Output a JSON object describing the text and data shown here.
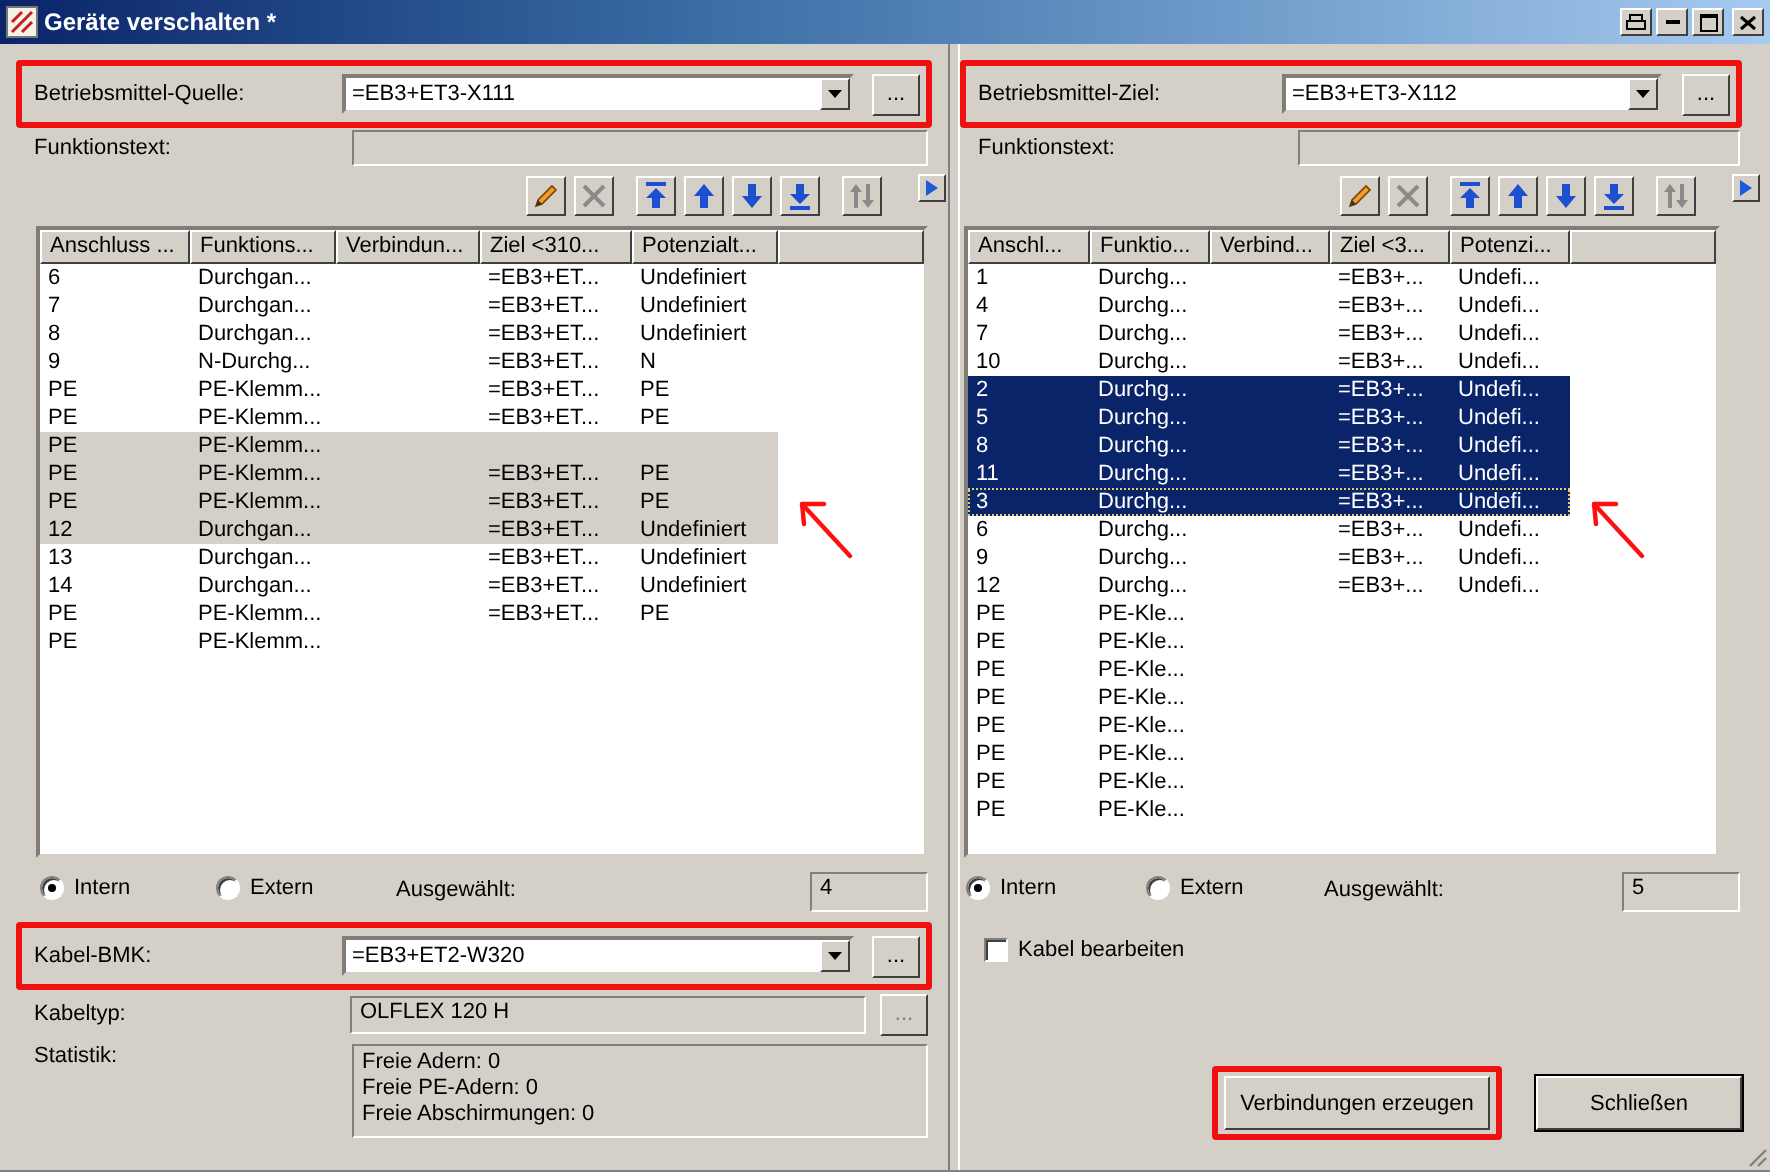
{
  "window": {
    "title": "Geräte verschalten *"
  },
  "source": {
    "highlighted": true,
    "label": "Betriebsmittel-Quelle:",
    "value": "=EB3+ET3-X111",
    "browse_label": "...",
    "function_label": "Funktionstext:",
    "toolbar": [
      {
        "kind": "edit",
        "disabled": false
      },
      {
        "kind": "delete",
        "disabled": true
      },
      {
        "kind": "top",
        "disabled": false
      },
      {
        "kind": "up",
        "disabled": false
      },
      {
        "kind": "down",
        "disabled": false
      },
      {
        "kind": "bottom",
        "disabled": false
      },
      {
        "kind": "swap",
        "disabled": true
      },
      {
        "kind": "more",
        "disabled": false
      }
    ],
    "table": {
      "focused": false,
      "annotation_arrow": true,
      "columns": [
        "Anschluss ...",
        "Funktions...",
        "Verbindun...",
        "Ziel <310...",
        "Potenzialt..."
      ],
      "rows": [
        {
          "cells": [
            "6",
            "Durchgan...",
            null,
            "=EB3+ET...",
            "Undefiniert"
          ],
          "selected": false,
          "focused": false
        },
        {
          "cells": [
            "7",
            "Durchgan...",
            null,
            "=EB3+ET...",
            "Undefiniert"
          ],
          "selected": false,
          "focused": false
        },
        {
          "cells": [
            "8",
            "Durchgan...",
            null,
            "=EB3+ET...",
            "Undefiniert"
          ],
          "selected": false,
          "focused": false
        },
        {
          "cells": [
            "9",
            "N-Durchg...",
            null,
            "=EB3+ET...",
            "N"
          ],
          "selected": false,
          "focused": false
        },
        {
          "cells": [
            "PE",
            "PE-Klemm...",
            null,
            "=EB3+ET...",
            "PE"
          ],
          "selected": false,
          "focused": false
        },
        {
          "cells": [
            "PE",
            "PE-Klemm...",
            null,
            "=EB3+ET...",
            "PE"
          ],
          "selected": false,
          "focused": false
        },
        {
          "cells": [
            "PE",
            "PE-Klemm...",
            null,
            null,
            null
          ],
          "selected": true,
          "focused": false
        },
        {
          "cells": [
            "PE",
            "PE-Klemm...",
            null,
            "=EB3+ET...",
            "PE"
          ],
          "selected": true,
          "focused": false
        },
        {
          "cells": [
            "PE",
            "PE-Klemm...",
            null,
            "=EB3+ET...",
            "PE"
          ],
          "selected": true,
          "focused": false
        },
        {
          "cells": [
            "12",
            "Durchgan...",
            null,
            "=EB3+ET...",
            "Undefiniert"
          ],
          "selected": true,
          "focused": false
        },
        {
          "cells": [
            "13",
            "Durchgan...",
            null,
            "=EB3+ET...",
            "Undefiniert"
          ],
          "selected": false,
          "focused": false
        },
        {
          "cells": [
            "14",
            "Durchgan...",
            null,
            "=EB3+ET...",
            "Undefiniert"
          ],
          "selected": false,
          "focused": false
        },
        {
          "cells": [
            "PE",
            "PE-Klemm...",
            null,
            "=EB3+ET...",
            "PE"
          ],
          "selected": false,
          "focused": false
        },
        {
          "cells": [
            "PE",
            "PE-Klemm...",
            null,
            null,
            null
          ],
          "selected": false,
          "focused": false
        }
      ]
    },
    "radios": [
      {
        "label": "Intern",
        "selected": true
      },
      {
        "label": "Extern",
        "selected": false
      }
    ],
    "count_label": "Ausgewählt:",
    "count": "4"
  },
  "cable": {
    "highlighted": true,
    "label": "Kabel-BMK:",
    "value": "=EB3+ET2-W320",
    "browse_label": "...",
    "type_label": "Kabeltyp:",
    "type_value": "OLFLEX 120 H",
    "type_browse_label": "...",
    "stats_label": "Statistik:",
    "stats": [
      "Freie Adern: 0",
      "Freie PE-Adern: 0",
      "Freie Abschirmungen: 0"
    ]
  },
  "target": {
    "highlighted": true,
    "label": "Betriebsmittel-Ziel:",
    "value": "=EB3+ET3-X112",
    "browse_label": "...",
    "function_label": "Funktionstext:",
    "toolbar": [
      {
        "kind": "edit",
        "disabled": false
      },
      {
        "kind": "delete",
        "disabled": true
      },
      {
        "kind": "top",
        "disabled": false
      },
      {
        "kind": "up",
        "disabled": false
      },
      {
        "kind": "down",
        "disabled": false
      },
      {
        "kind": "bottom",
        "disabled": false
      },
      {
        "kind": "swap",
        "disabled": true
      },
      {
        "kind": "more",
        "disabled": false
      }
    ],
    "table": {
      "focused": true,
      "annotation_arrow": true,
      "columns": [
        "Anschl...",
        "Funktio...",
        "Verbind...",
        "Ziel <3...",
        "Potenzi..."
      ],
      "rows": [
        {
          "cells": [
            "1",
            "Durchg...",
            null,
            "=EB3+...",
            "Undefi..."
          ],
          "selected": false,
          "focused": false
        },
        {
          "cells": [
            "4",
            "Durchg...",
            null,
            "=EB3+...",
            "Undefi..."
          ],
          "selected": false,
          "focused": false
        },
        {
          "cells": [
            "7",
            "Durchg...",
            null,
            "=EB3+...",
            "Undefi..."
          ],
          "selected": false,
          "focused": false
        },
        {
          "cells": [
            "10",
            "Durchg...",
            null,
            "=EB3+...",
            "Undefi..."
          ],
          "selected": false,
          "focused": false
        },
        {
          "cells": [
            "2",
            "Durchg...",
            null,
            "=EB3+...",
            "Undefi..."
          ],
          "selected": true,
          "focused": false
        },
        {
          "cells": [
            "5",
            "Durchg...",
            null,
            "=EB3+...",
            "Undefi..."
          ],
          "selected": true,
          "focused": false
        },
        {
          "cells": [
            "8",
            "Durchg...",
            null,
            "=EB3+...",
            "Undefi..."
          ],
          "selected": true,
          "focused": false
        },
        {
          "cells": [
            "11",
            "Durchg...",
            null,
            "=EB3+...",
            "Undefi..."
          ],
          "selected": true,
          "focused": false
        },
        {
          "cells": [
            "3",
            "Durchg...",
            null,
            "=EB3+...",
            "Undefi..."
          ],
          "selected": true,
          "focused": true
        },
        {
          "cells": [
            "6",
            "Durchg...",
            null,
            "=EB3+...",
            "Undefi..."
          ],
          "selected": false,
          "focused": false
        },
        {
          "cells": [
            "9",
            "Durchg...",
            null,
            "=EB3+...",
            "Undefi..."
          ],
          "selected": false,
          "focused": false
        },
        {
          "cells": [
            "12",
            "Durchg...",
            null,
            "=EB3+...",
            "Undefi..."
          ],
          "selected": false,
          "focused": false
        },
        {
          "cells": [
            "PE",
            "PE-Kle...",
            null,
            null,
            null
          ],
          "selected": false,
          "focused": false
        },
        {
          "cells": [
            "PE",
            "PE-Kle...",
            null,
            null,
            null
          ],
          "selected": false,
          "focused": false
        },
        {
          "cells": [
            "PE",
            "PE-Kle...",
            null,
            null,
            null
          ],
          "selected": false,
          "focused": false
        },
        {
          "cells": [
            "PE",
            "PE-Kle...",
            null,
            null,
            null
          ],
          "selected": false,
          "focused": false
        },
        {
          "cells": [
            "PE",
            "PE-Kle...",
            null,
            null,
            null
          ],
          "selected": false,
          "focused": false
        },
        {
          "cells": [
            "PE",
            "PE-Kle...",
            null,
            null,
            null
          ],
          "selected": false,
          "focused": false
        },
        {
          "cells": [
            "PE",
            "PE-Kle...",
            null,
            null,
            null
          ],
          "selected": false,
          "focused": false
        },
        {
          "cells": [
            "PE",
            "PE-Kle...",
            null,
            null,
            null
          ],
          "selected": false,
          "focused": false
        }
      ]
    },
    "radios": [
      {
        "label": "Intern",
        "selected": true
      },
      {
        "label": "Extern",
        "selected": false
      }
    ],
    "count_label": "Ausgewählt:",
    "count": "5",
    "edit_cable": {
      "label": "Kabel bearbeiten",
      "checked": false
    }
  },
  "buttons": [
    {
      "label": "Verbindungen erzeugen",
      "highlighted": true,
      "default": false
    },
    {
      "label": "Schließen",
      "highlighted": false,
      "default": true
    }
  ]
}
